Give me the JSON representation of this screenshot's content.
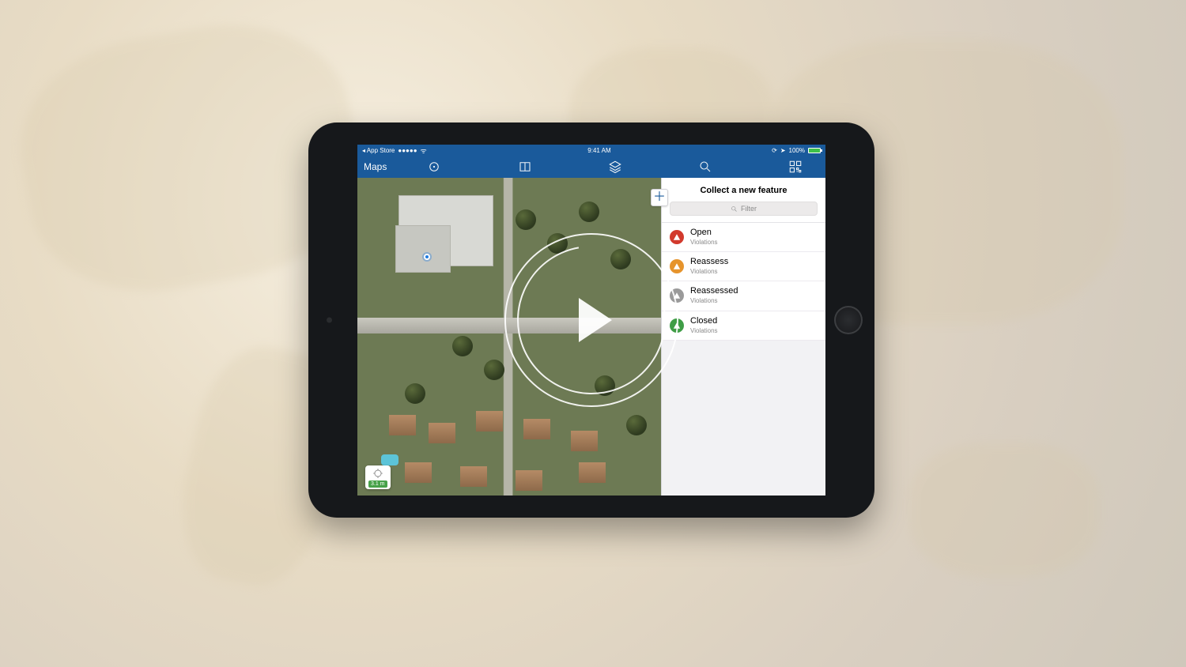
{
  "statusbar": {
    "back_app": "App Store",
    "signal_dots": "●●●●●",
    "time": "9:41 AM",
    "battery_pct": "100%"
  },
  "toolbar": {
    "title": "Maps"
  },
  "gps": {
    "distance": "3.1 m"
  },
  "panel": {
    "title": "Collect a new feature",
    "filter_placeholder": "Filter",
    "features": [
      {
        "label": "Open",
        "sub": "Violations",
        "color": "red"
      },
      {
        "label": "Reassess",
        "sub": "Violations",
        "color": "orange"
      },
      {
        "label": "Reassessed",
        "sub": "Violations",
        "color": "gray"
      },
      {
        "label": "Closed",
        "sub": "Violations",
        "color": "green"
      }
    ]
  }
}
